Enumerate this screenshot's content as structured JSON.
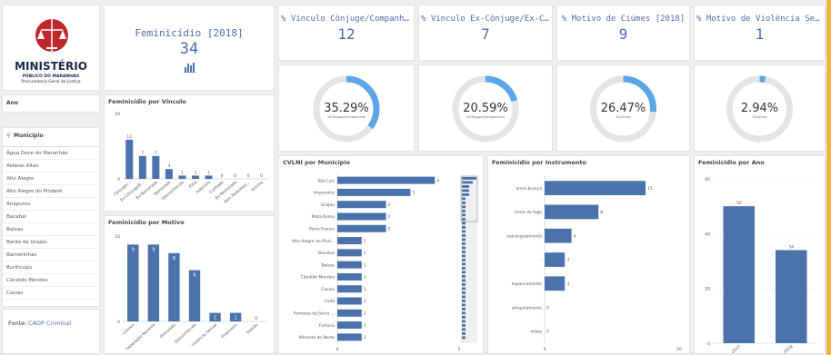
{
  "logo": {
    "brand": "MINISTÉRIO",
    "sub1": "PÚBLICO DO MARANHÃO",
    "sub2": "Procuradoria Geral de Justiça"
  },
  "filters": {
    "ano_label": "Ano",
    "municipio_label": "Município",
    "municipios": [
      "Água Doce do Maranhão",
      "Aldeias Altas",
      "Alto Alegre",
      "Alto Alegre do Pindaré",
      "Anapurus",
      "Bacabal",
      "Baixas",
      "Barão de Grajaú",
      "Barreirinhas",
      "Buriticupu",
      "Cândido Mendes",
      "Caxias"
    ]
  },
  "source": {
    "label": "Fonte:",
    "value": "CAOP Criminal"
  },
  "kpis": [
    {
      "title": "Feminicídio [2018]",
      "value": "34"
    },
    {
      "title": "% Vínculo Cônjuge/Companheir...",
      "value": "12"
    },
    {
      "title": "% Vínculo Ex-Cônjuge/Ex-Comp...",
      "value": "7"
    },
    {
      "title": "% Motivo de Ciúmes [2018]",
      "value": "9"
    },
    {
      "title": "% Motivo de Violência Sexual [2...",
      "value": "1"
    }
  ],
  "gauges": [
    {
      "pct": "35.29%",
      "sub": "%Cônjuge/Companheiro",
      "fraction": 0.3529
    },
    {
      "pct": "20.59%",
      "sub": "%Cônjuge/Companheiro",
      "fraction": 0.2059
    },
    {
      "pct": "26.47%",
      "sub": "%Ciúmes",
      "fraction": 0.2647
    },
    {
      "pct": "2.94%",
      "sub": "%Ciúmes",
      "fraction": 0.0294
    }
  ],
  "colors": {
    "bar": "#4a72ab",
    "gauge_fill": "#5aa6e8",
    "gauge_track": "#e4e4e4",
    "kpi_text": "#4a6ea8",
    "accent": "#f2b640"
  },
  "chart_data": [
    {
      "id": "vinculo",
      "type": "bar",
      "title": "Feminicídio por Vínculo",
      "categories": [
        "Cônjuge/...",
        "Ex-Cônjuge/E...",
        "Ex-Namorado",
        "Namorado",
        "Desconhecido",
        "Filho",
        "Sobrinho",
        "Cunhado",
        "Ex-Namorado",
        "Sem Parentesc...",
        "Vizinho"
      ],
      "values": [
        12,
        7,
        7,
        3,
        1,
        1,
        1,
        0,
        0,
        0,
        0
      ],
      "yticks": [
        0,
        20
      ]
    },
    {
      "id": "motivo",
      "type": "bar",
      "title": "Feminicídio por Motivo",
      "categories": [
        "Ciúmes",
        "Separação Recente",
        "Discussão",
        "Desconhecido",
        "Violência Sexual",
        "Financeiro",
        "Traição"
      ],
      "values": [
        9,
        9,
        8,
        6,
        1,
        1,
        0
      ],
      "yticks": [
        0,
        10
      ]
    },
    {
      "id": "municipio",
      "type": "bar",
      "title": "CVLNI por Município",
      "categories": [
        "São Luís",
        "Imperatriz",
        "Grajaú",
        "Mata Roma",
        "Porto Franco",
        "Alto Alegre do Pind...",
        "Bacabal",
        "Balsas",
        "Cândido Mendes",
        "Caxias",
        "Codó",
        "Formosa da Serra ...",
        "Fortuna",
        "Miranda do Norte"
      ],
      "values": [
        4,
        3,
        2,
        2,
        2,
        1,
        1,
        1,
        1,
        1,
        1,
        1,
        1,
        1
      ],
      "xticks": [
        0,
        5
      ]
    },
    {
      "id": "instrumento",
      "type": "bar",
      "title": "Feminicídio por Instrumento",
      "categories": [
        "arma branca",
        "arma de fogo",
        "estrangulamento",
        "-",
        "espancamento",
        "atropelamento",
        "mãos"
      ],
      "values": [
        15,
        8,
        4,
        3,
        3,
        0,
        0
      ],
      "xticks": [
        0,
        20
      ]
    },
    {
      "id": "ano",
      "type": "bar",
      "title": "Feminicídio por Ano",
      "categories": [
        "2017",
        "2018"
      ],
      "values": [
        50,
        34
      ],
      "yticks": [
        0,
        20,
        40,
        60
      ]
    }
  ]
}
